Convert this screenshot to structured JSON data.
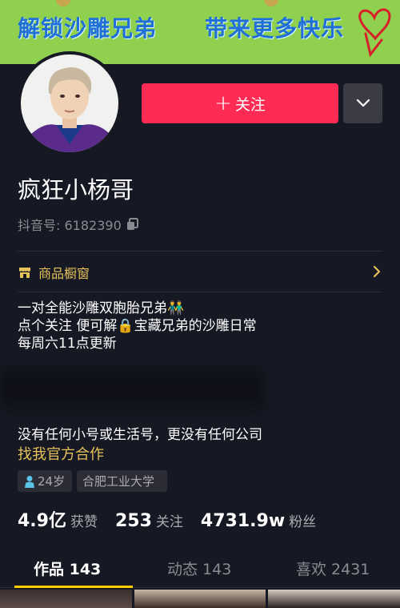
{
  "banner": {
    "left_text": "解锁沙雕兄弟",
    "right_text": "带来更多快乐"
  },
  "profile": {
    "follow_label": "关注",
    "nickname": "疯狂小杨哥",
    "douyin_id_label": "抖音号: ",
    "douyin_id": "6182390"
  },
  "shop": {
    "label": "商品橱窗"
  },
  "bio": {
    "lines": [
      "一对全能沙雕双胞胎兄弟👬",
      "点个关注 便可解🔒宝藏兄弟的沙雕日常",
      "每周六11点更新"
    ],
    "note": "没有任何小号或生活号，更没有任何公司",
    "collab_link": "找我官方合作"
  },
  "tags": {
    "age": "24岁",
    "school": "合肥工业大学"
  },
  "stats": {
    "likes_value": "4.9亿",
    "likes_label": "获赞",
    "following_value": "253",
    "following_label": "关注",
    "followers_value": "4731.9w",
    "followers_label": "粉丝"
  },
  "tabs": {
    "works": "作品 143",
    "moments": "动态 143",
    "likes": "喜欢 2431"
  },
  "colors": {
    "accent_red": "#fe2c55",
    "gold": "#e6c25a",
    "tab_indicator": "#fece00",
    "background": "#161823"
  }
}
